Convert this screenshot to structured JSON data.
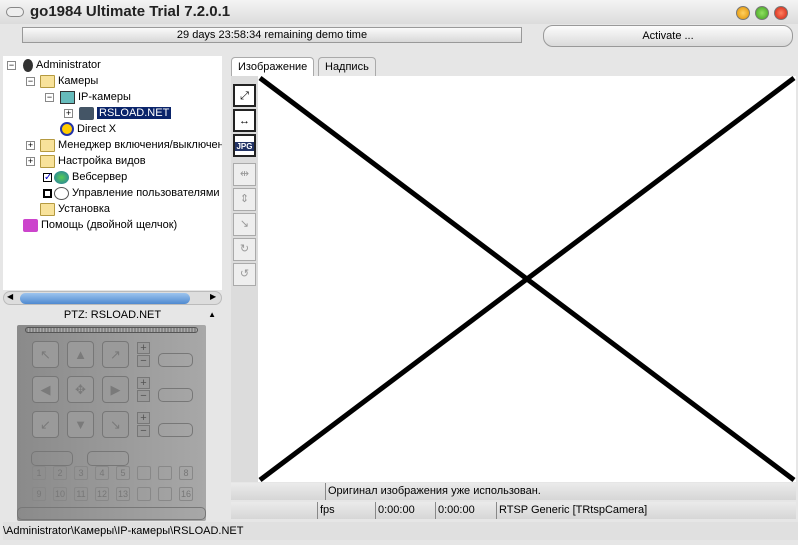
{
  "window": {
    "title": "go1984 Ultimate Trial 7.2.0.1",
    "demo_status": "29 days 23:58:34 remaining demo time",
    "activate_label": "Activate ..."
  },
  "tree": {
    "items": [
      {
        "label": "Administrator",
        "icon": "user-icon"
      },
      {
        "label": "Камеры",
        "icon": "folder-open-icon"
      },
      {
        "label": "IP-камеры",
        "icon": "ip-camera-icon"
      },
      {
        "label": "RSLOAD.NET",
        "icon": "camera-icon",
        "selected": true
      },
      {
        "label": "Direct X",
        "icon": "directx-icon"
      },
      {
        "label": "Менеджер включения/выключения",
        "icon": "folder-icon"
      },
      {
        "label": "Настройка видов",
        "icon": "folder-icon"
      },
      {
        "label": "Вебсервер",
        "icon": "globe-icon",
        "checked": true
      },
      {
        "label": "Управление пользователями",
        "icon": "users-icon",
        "checked": false
      },
      {
        "label": "Установка",
        "icon": "setup-folder-icon"
      },
      {
        "label": "Помощь (двойной щелчок)",
        "icon": "help-book-icon"
      }
    ]
  },
  "ptz": {
    "title": "PTZ: RSLOAD.NET",
    "presets": [
      "1",
      "2",
      "3",
      "4",
      "5",
      "",
      "",
      "8",
      "9",
      "10",
      "11",
      "12",
      "13",
      "",
      "",
      "16"
    ]
  },
  "tabs": [
    {
      "label": "Изображение",
      "active": true
    },
    {
      "label": "Надпись",
      "active": false
    }
  ],
  "toolbar": {
    "jpg_label": "JPG"
  },
  "status": {
    "message": "Оригинал изображения уже использован.",
    "fps": "fps",
    "time1": "0:00:00",
    "time2": "0:00:00",
    "camera_type": "RTSP Generic [TRtspCamera]"
  },
  "path": "\\Administrator\\Камеры\\IP-камеры\\RSLOAD.NET"
}
